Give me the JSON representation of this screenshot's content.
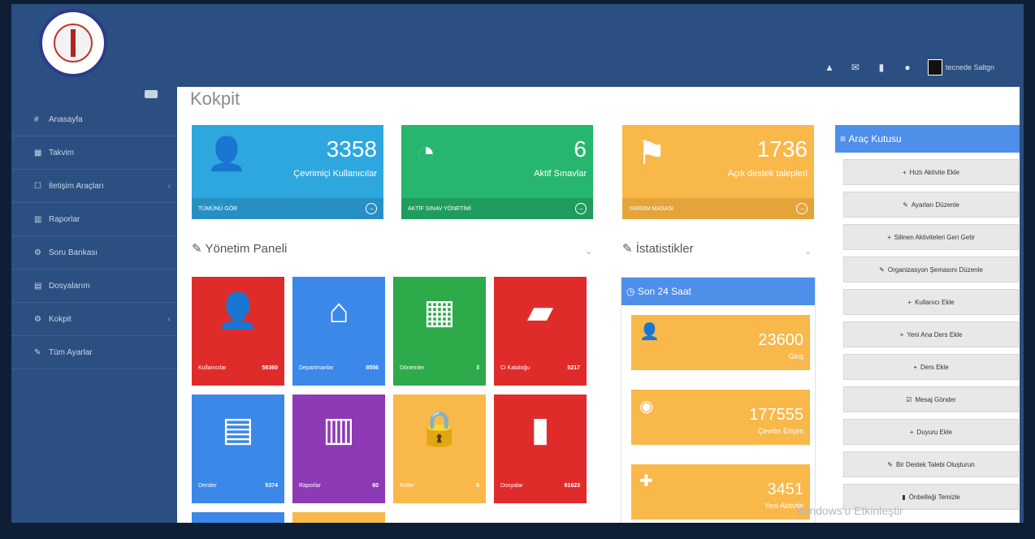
{
  "header": {
    "logo_name": "university-seal",
    "icons": [
      "warning-icon",
      "mail-icon",
      "bookmark-icon",
      "chat-icon"
    ],
    "user_name": "tecnede Saltgn"
  },
  "sidebar": {
    "items": [
      {
        "icon": "#",
        "label": "Anasayfa",
        "chevron": false
      },
      {
        "icon": "▦",
        "label": "Takvim",
        "chevron": false
      },
      {
        "icon": "☐",
        "label": "İletişim Araçları",
        "chevron": true
      },
      {
        "icon": "▥",
        "label": "Raporlar",
        "chevron": false
      },
      {
        "icon": "⚙",
        "label": "Soru Bankası",
        "chevron": false
      },
      {
        "icon": "▤",
        "label": "Dosyalarım",
        "chevron": false
      },
      {
        "icon": "⚙",
        "label": "Kokpit",
        "chevron": true
      },
      {
        "icon": "✎",
        "label": "Tüm Ayarlar",
        "chevron": false
      }
    ]
  },
  "page": {
    "title": "Kokpit"
  },
  "stats": [
    {
      "value": "3358",
      "label": "Çevrimiçi Kullanıcılar",
      "footer": "TÜMÜNÜ GÖR",
      "icon": "user-icon",
      "color": "#2ea7df"
    },
    {
      "value": "6",
      "label": "Aktif Sınavlar",
      "footer": "AKTİF SINAV YÖNETİMİ",
      "icon": "dashboard-icon",
      "color": "#27b66f"
    },
    {
      "value": "1736",
      "label": "Açık destek talepleri",
      "footer": "YARDIM MASASI",
      "icon": "flag-icon",
      "color": "#f9b84a"
    }
  ],
  "yonetim": {
    "title": "Yönetim Paneli",
    "tiles": [
      {
        "label": "Kullanıcılar",
        "value": "58360",
        "icon": "user-icon",
        "color": "#e02b2b"
      },
      {
        "label": "Departmanlar",
        "value": "8556",
        "icon": "sitemap-icon",
        "color": "#3b88e8"
      },
      {
        "label": "Dönemler",
        "value": "3",
        "icon": "calendar-icon",
        "color": "#2daa4a"
      },
      {
        "label": "Ci Kataloğu",
        "value": "5217",
        "icon": "folder-icon",
        "color": "#e02b2b"
      },
      {
        "label": "Dersler",
        "value": "5374",
        "icon": "book-icon",
        "color": "#3b88e8"
      },
      {
        "label": "Raporlar",
        "value": "60",
        "icon": "chart-icon",
        "color": "#8e3ab5"
      },
      {
        "label": "Roller",
        "value": "6",
        "icon": "lock-icon",
        "color": "#f9b84a"
      },
      {
        "label": "Dosyalar",
        "value": "91623",
        "icon": "file-icon",
        "color": "#e02b2b"
      }
    ]
  },
  "istatistik": {
    "title": "İstatistikler",
    "head": "Son 24 Saat",
    "cards": [
      {
        "value": "23600",
        "label": "Giriş",
        "icon": "user-icon"
      },
      {
        "value": "177555",
        "label": "Çevrim Erişim",
        "icon": "eye-icon"
      },
      {
        "value": "3451",
        "label": "Yeni Aktivite",
        "icon": "plus-icon"
      }
    ]
  },
  "toolbox": {
    "title": "Araç Kutusu",
    "buttons": [
      {
        "glyph": "+",
        "label": "Hızlı Aktivite Ekle"
      },
      {
        "glyph": "✎",
        "label": "Ayarları Düzenle"
      },
      {
        "glyph": "+",
        "label": "Silinen Aktiviteleri Geri Getir"
      },
      {
        "glyph": "✎",
        "label": "Organizasyon Şemasını Düzenle"
      },
      {
        "glyph": "+",
        "label": "Kullanıcı Ekle"
      },
      {
        "glyph": "+",
        "label": "Yeni Ana Ders Ekle"
      },
      {
        "glyph": "+",
        "label": "Ders Ekle"
      },
      {
        "glyph": "☑",
        "label": "Mesaj Gönder"
      },
      {
        "glyph": "+",
        "label": "Duyuru Ekle"
      },
      {
        "glyph": "✎",
        "label": "Bir Destek Talebi Oluşturun"
      },
      {
        "glyph": "▮",
        "label": "Önbelleği Temizle"
      }
    ]
  },
  "watermark": "Windows'u Etkinleştir"
}
